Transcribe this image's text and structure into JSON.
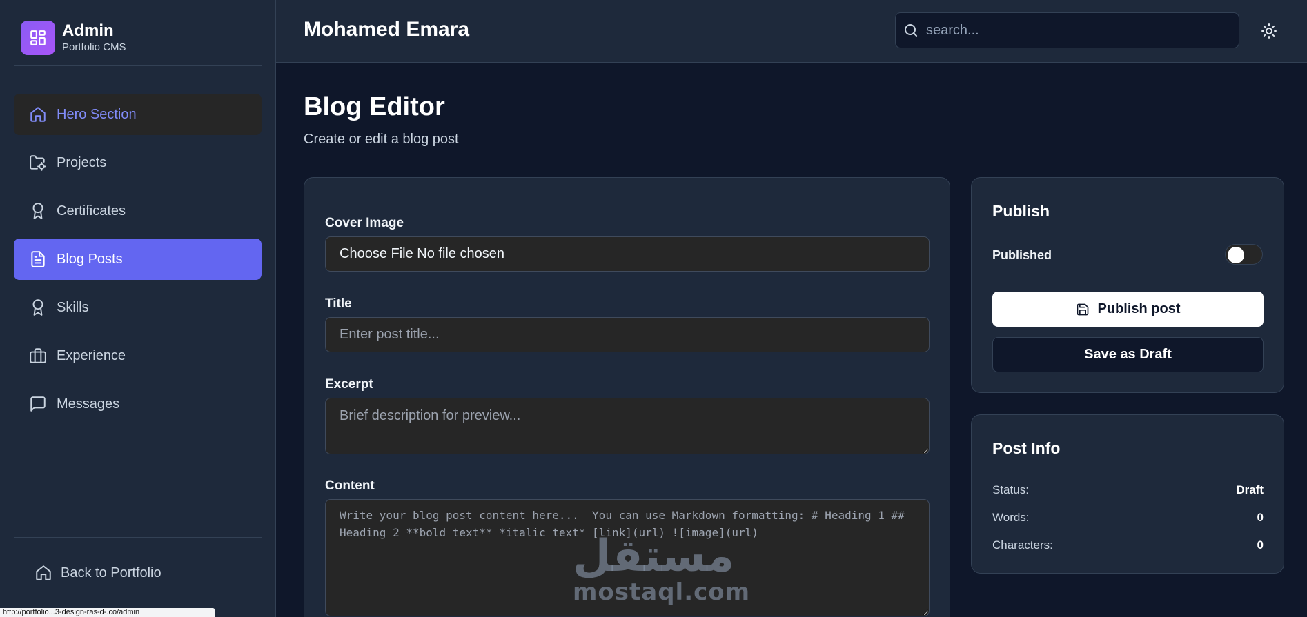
{
  "brand": {
    "title": "Admin",
    "subtitle": "Portfolio CMS",
    "icon": "dashboard-grid-icon",
    "accent": "#8b5cf6"
  },
  "sidebar": {
    "items": [
      {
        "label": "Hero Section",
        "icon": "home-icon",
        "state": "hover"
      },
      {
        "label": "Projects",
        "icon": "folder-icon",
        "state": "default"
      },
      {
        "label": "Certificates",
        "icon": "award-icon",
        "state": "default"
      },
      {
        "label": "Blog Posts",
        "icon": "document-icon",
        "state": "active"
      },
      {
        "label": "Skills",
        "icon": "award-icon",
        "state": "default"
      },
      {
        "label": "Experience",
        "icon": "briefcase-icon",
        "state": "default"
      },
      {
        "label": "Messages",
        "icon": "message-icon",
        "state": "default"
      }
    ],
    "back_label": "Back to Portfolio",
    "active_color": "#6366f1"
  },
  "status_bar": {
    "url": "http://portfolio...3-design-ras-d-.co/admin"
  },
  "header": {
    "title": "Mohamed Emara",
    "search_placeholder": "search...",
    "theme_icon": "sun-icon"
  },
  "page": {
    "title": "Blog Editor",
    "subtitle": "Create or edit a blog post"
  },
  "editor": {
    "cover_label": "Cover Image",
    "cover_value": "Choose File No file chosen",
    "title_label": "Title",
    "title_placeholder": "Enter post title...",
    "excerpt_label": "Excerpt",
    "excerpt_placeholder": "Brief description for preview...",
    "content_label": "Content",
    "content_placeholder": "Write your blog post content here...  You can use Markdown formatting: # Heading 1 ## Heading 2 **bold text** *italic text* [link](url) ![image](url)"
  },
  "publish": {
    "title": "Publish",
    "published_label": "Published",
    "published_on": false,
    "publish_button": "Publish post",
    "publish_icon": "save-icon",
    "draft_button": "Save as Draft"
  },
  "post_info": {
    "title": "Post Info",
    "rows": [
      {
        "key": "Status:",
        "value": "Draft"
      },
      {
        "key": "Words:",
        "value": "0"
      },
      {
        "key": "Characters:",
        "value": "0"
      }
    ]
  },
  "watermark": {
    "arabic": "مستقل",
    "latin": "mostaql.com"
  }
}
